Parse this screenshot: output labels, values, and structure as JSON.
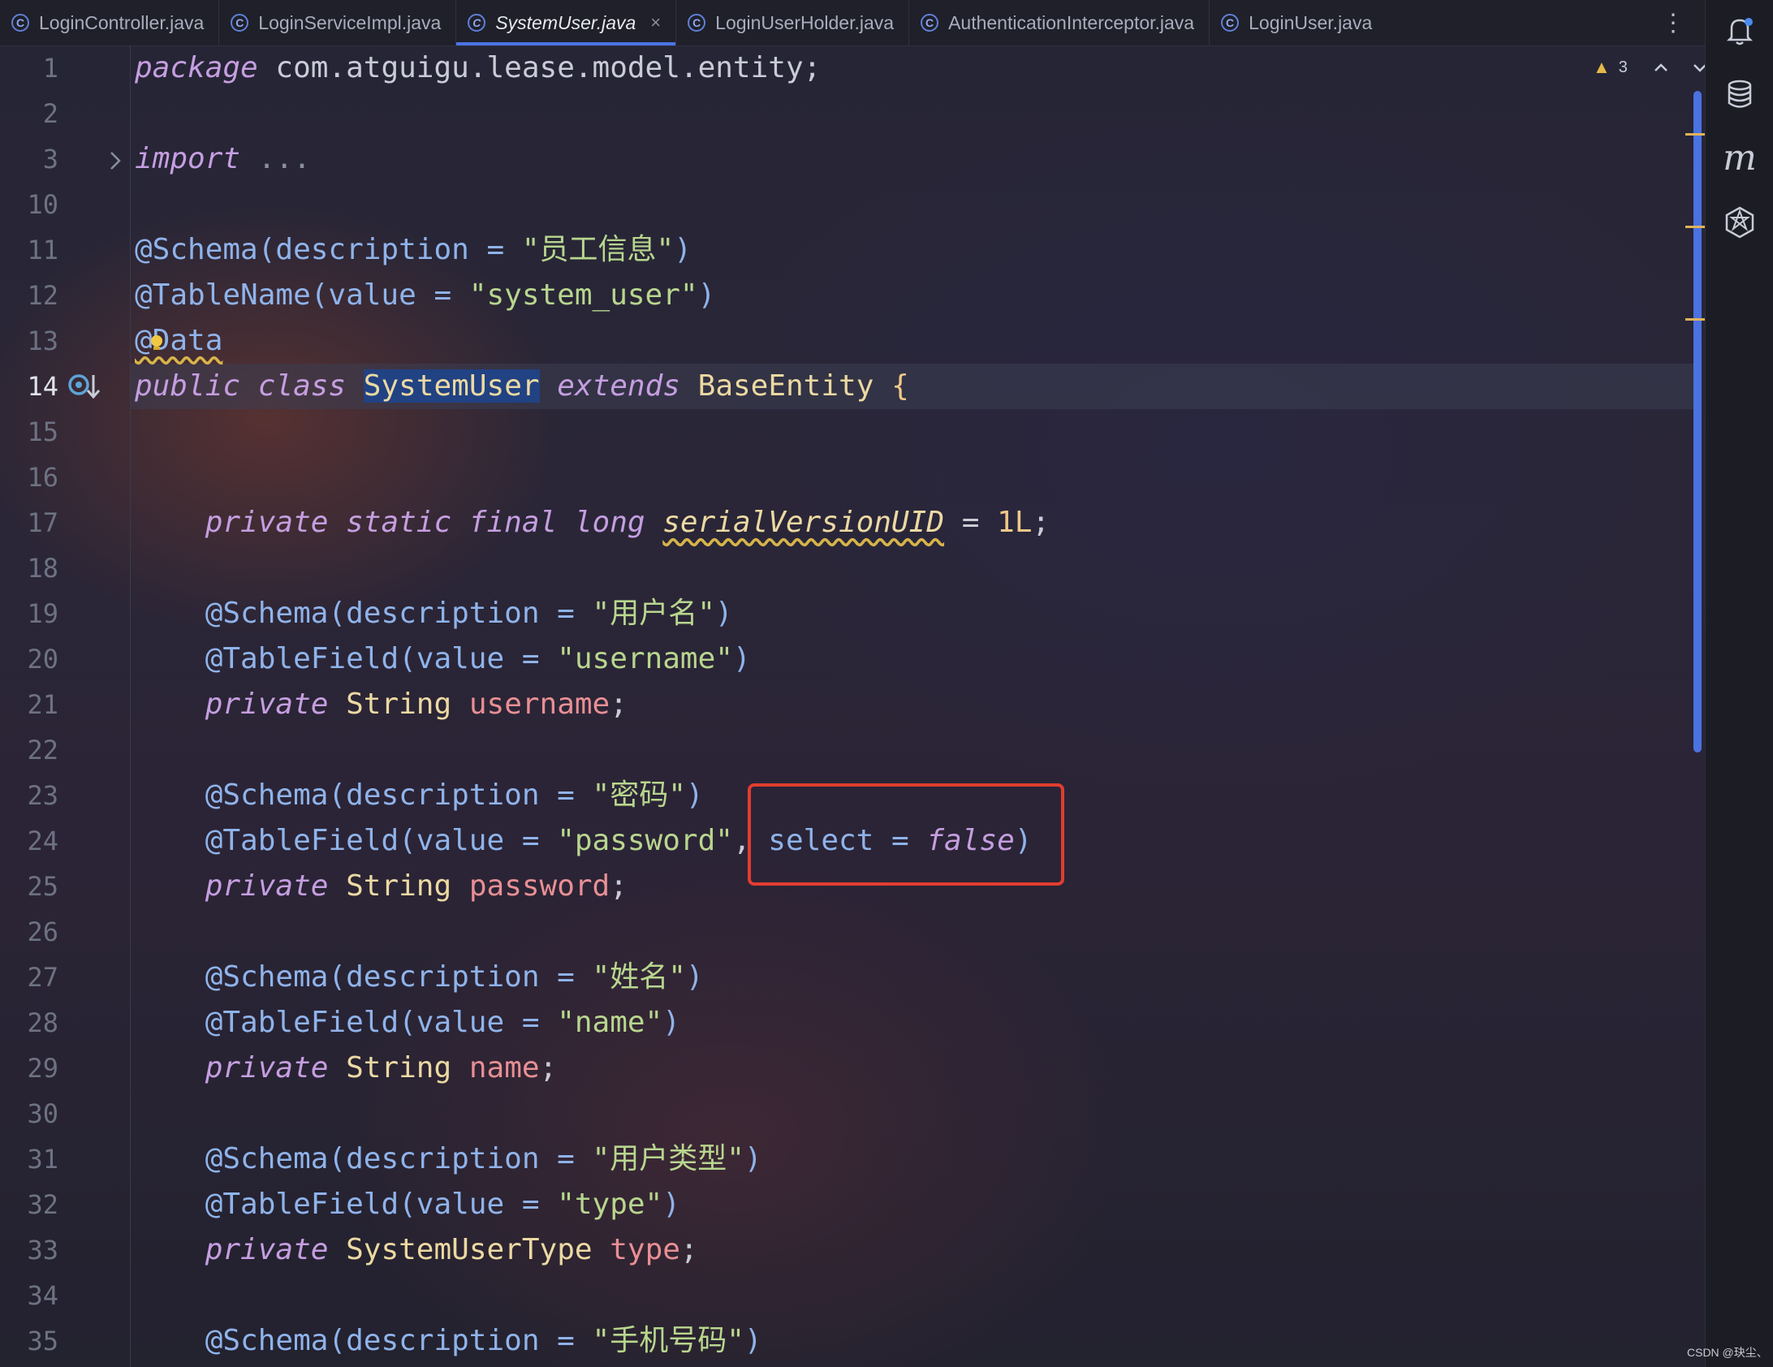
{
  "tabs": [
    {
      "label": "LoginController.java",
      "active": false
    },
    {
      "label": "LoginServiceImpl.java",
      "active": false
    },
    {
      "label": "SystemUser.java",
      "active": true
    },
    {
      "label": "LoginUserHolder.java",
      "active": false
    },
    {
      "label": "AuthenticationInterceptor.java",
      "active": false
    },
    {
      "label": "LoginUser.java",
      "active": false
    }
  ],
  "tab_icon_letter": "C",
  "tab_close_glyph": "×",
  "tab_more_glyph": "⋮",
  "inspections": {
    "warning_count": "3"
  },
  "line_numbers": [
    "1",
    "2",
    "3",
    "10",
    "11",
    "12",
    "13",
    "14",
    "15",
    "16",
    "17",
    "18",
    "19",
    "20",
    "21",
    "22",
    "23",
    "24",
    "25",
    "26",
    "27",
    "28",
    "29",
    "30",
    "31",
    "32",
    "33",
    "34",
    "35"
  ],
  "current_line": "14",
  "code": {
    "l1": {
      "kw": "package",
      "pkg": "com.atguigu.lease.model.entity;"
    },
    "l3": {
      "kw": "import",
      "rest": "..."
    },
    "l11": {
      "ann": "@Schema(description = ",
      "str": "\"员工信息\"",
      "close": ")"
    },
    "l12": {
      "ann": "@TableName(value = ",
      "str": "\"system_user\"",
      "close": ")"
    },
    "l13": {
      "ann": "@Data"
    },
    "l14": {
      "kw1": "public",
      "kw2": "class",
      "cls": "SystemUser",
      "kw3": "extends",
      "base": "BaseEntity",
      "brace": "{"
    },
    "l17": {
      "mods": "private static final long",
      "name": "serialVersionUID",
      "eq": " = ",
      "val": "1L",
      "semi": ";"
    },
    "l19": {
      "ann": "@Schema(description = ",
      "str": "\"用户名\"",
      "close": ")"
    },
    "l20": {
      "ann": "@TableField(value = ",
      "str": "\"username\"",
      "close": ")"
    },
    "l21": {
      "kw": "private",
      "type": "String",
      "name": "username",
      "semi": ";"
    },
    "l23": {
      "ann": "@Schema(description = ",
      "str": "\"密码\"",
      "close": ")"
    },
    "l24": {
      "ann": "@TableField(value = ",
      "str": "\"password\"",
      "comma": ",",
      "select": " select = ",
      "val": "false",
      "close": ")"
    },
    "l25": {
      "kw": "private",
      "type": "String",
      "name": "password",
      "semi": ";"
    },
    "l27": {
      "ann": "@Schema(description = ",
      "str": "\"姓名\"",
      "close": ")"
    },
    "l28": {
      "ann": "@TableField(value = ",
      "str": "\"name\"",
      "close": ")"
    },
    "l29": {
      "kw": "private",
      "type": "String",
      "name": "name",
      "semi": ";"
    },
    "l31": {
      "ann": "@Schema(description = ",
      "str": "\"用户类型\"",
      "close": ")"
    },
    "l32": {
      "ann": "@TableField(value = ",
      "str": "\"type\"",
      "close": ")"
    },
    "l33": {
      "kw": "private",
      "type": "SystemUserType",
      "name": "type",
      "semi": ";"
    },
    "l35": {
      "ann": "@Schema(description = ",
      "str": "\"手机号码\"",
      "close": ")"
    }
  },
  "toolwindows": [
    "notifications-icon",
    "database-icon",
    "maven-icon",
    "ai-assistant-icon"
  ],
  "maven_letter": "m",
  "watermark": "CSDN @玦尘、",
  "colors": {
    "accent": "#4b74e6",
    "highlight_box": "#e23d2f",
    "keyword": "#c59ee0",
    "annotation": "#8fb3ea",
    "string": "#b8d68e"
  }
}
